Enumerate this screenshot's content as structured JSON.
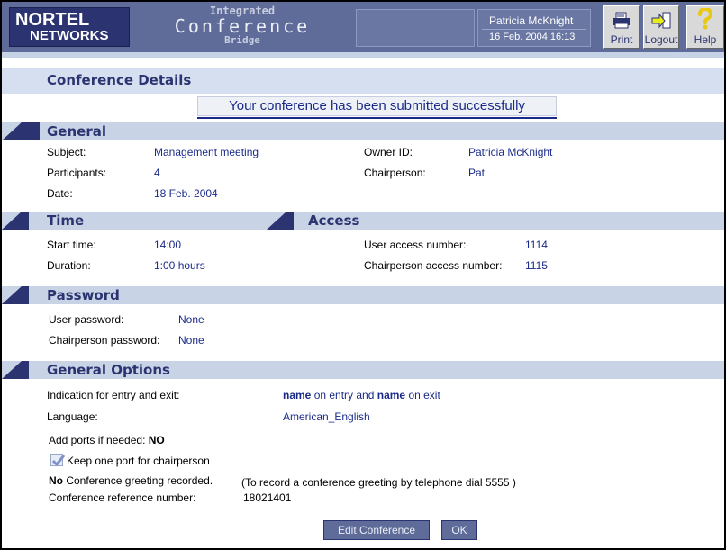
{
  "header": {
    "logo_line1": "NORTEL",
    "logo_line2": "NETWORKS",
    "app_line1": "Integrated",
    "app_line2": "Conference",
    "app_line3": "Bridge",
    "user_name": "Patricia McKnight",
    "datetime": "16 Feb. 2004 16:13",
    "print_label": "Print",
    "logout_label": "Logout",
    "help_label": "Help"
  },
  "page_title": "Conference Details",
  "success_message": "Your conference has been submitted successfully",
  "general": {
    "title": "General",
    "subject_label": "Subject:",
    "subject_value": "Management meeting",
    "participants_label": "Participants:",
    "participants_value": "4",
    "date_label": "Date:",
    "date_value": "18 Feb. 2004",
    "owner_label": "Owner ID:",
    "owner_value": "Patricia McKnight",
    "chair_label": "Chairperson:",
    "chair_value": "Pat"
  },
  "time": {
    "title": "Time",
    "start_label": "Start time:",
    "start_value": "14:00",
    "duration_label": "Duration:",
    "duration_value": "1:00 hours"
  },
  "access": {
    "title": "Access",
    "user_label": "User access number:",
    "user_value": "1114",
    "chair_label": "Chairperson access number:",
    "chair_value": "1115"
  },
  "password": {
    "title": "Password",
    "user_label": "User password:",
    "user_value": "None",
    "chair_label": "Chairperson password:",
    "chair_value": "None"
  },
  "options": {
    "title": "General Options",
    "indication_label": "Indication for entry and exit:",
    "indication_w1": "name",
    "indication_t1": " on entry and ",
    "indication_w2": "name",
    "indication_t2": " on exit",
    "language_label": "Language:",
    "language_value": "American_English",
    "ports_label": "Add ports if needed:",
    "ports_value": "NO",
    "keep_port_label": "Keep one port for chairperson",
    "keep_port_checked": true,
    "greeting_bold": "No",
    "greeting_text": " Conference greeting recorded.",
    "greeting_hint": "(To record a conference greeting by telephone dial 5555 )",
    "ref_label": "Conference reference number:",
    "ref_value": "18021401"
  },
  "buttons": {
    "edit_label": "Edit Conference",
    "ok_label": "OK"
  },
  "colors": {
    "header_bg": "#5f6c99",
    "section_bg": "#c8d3e6",
    "value_text": "#1a2a8a"
  }
}
